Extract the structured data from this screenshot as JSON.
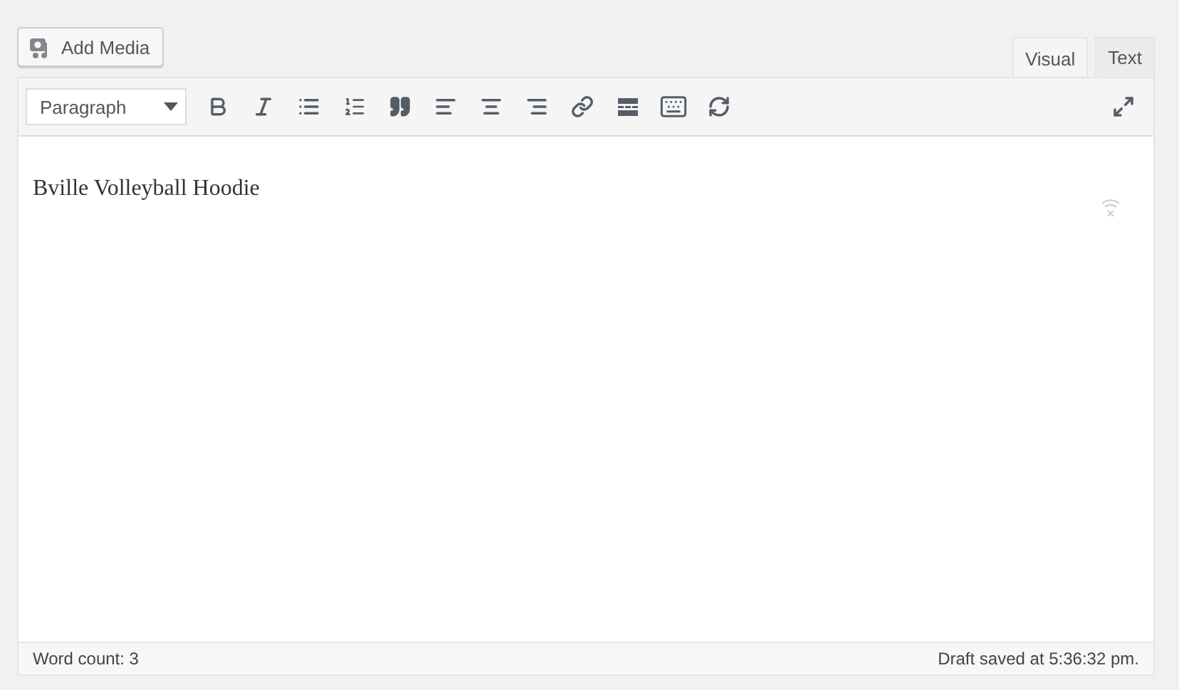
{
  "add_media_button": {
    "label": "Add Media"
  },
  "tabs": [
    {
      "label": "Visual",
      "selected": true
    },
    {
      "label": "Text",
      "selected": false
    }
  ],
  "toolbar": {
    "format_select": {
      "value": "Paragraph"
    },
    "buttons": [
      {
        "kind": "bold"
      },
      {
        "kind": "italic"
      },
      {
        "kind": "bullet-list"
      },
      {
        "kind": "numbered-list"
      },
      {
        "kind": "quote"
      },
      {
        "kind": "align-left"
      },
      {
        "kind": "align-center"
      },
      {
        "kind": "align-right"
      },
      {
        "kind": "link"
      },
      {
        "kind": "read-more"
      },
      {
        "kind": "toolbar-toggle"
      },
      {
        "kind": "sync"
      }
    ],
    "fullscreen": {
      "kind": "fullscreen"
    }
  },
  "content": {
    "text": "Bville Volleyball Hoodie"
  },
  "status_bar": {
    "word_count": "Word count: 3",
    "draft_saved": "Draft saved at 5:36:32 pm."
  }
}
